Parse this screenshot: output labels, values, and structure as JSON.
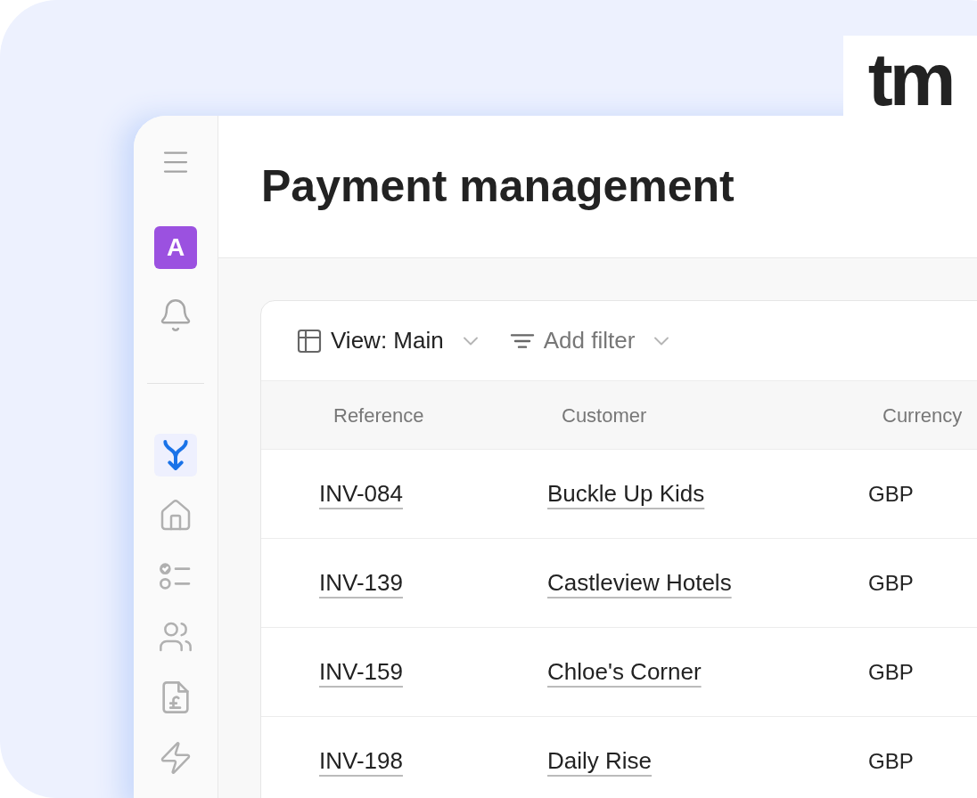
{
  "logo": {
    "text": "tm"
  },
  "sidebar": {
    "avatar": "A",
    "top_items": [
      {
        "kind": "menu"
      },
      {
        "kind": "avatar"
      },
      {
        "kind": "bell"
      }
    ],
    "nav_items": [
      {
        "kind": "merge",
        "selected": true
      },
      {
        "kind": "home",
        "selected": false
      },
      {
        "kind": "checklist",
        "selected": false
      },
      {
        "kind": "users",
        "selected": false
      },
      {
        "kind": "invoice",
        "selected": false
      },
      {
        "kind": "bolt",
        "selected": false
      }
    ]
  },
  "page": {
    "title": "Payment management"
  },
  "toolbar": {
    "view": "View: Main",
    "filter": "Add filter"
  },
  "table": {
    "columns": [
      "Reference",
      "Customer",
      "Currency"
    ],
    "rows": [
      {
        "reference": "INV-084",
        "customer": "Buckle Up Kids",
        "currency": "GBP"
      },
      {
        "reference": "INV-139",
        "customer": "Castleview Hotels",
        "currency": "GBP"
      },
      {
        "reference": "INV-159",
        "customer": "Chloe's Corner",
        "currency": "GBP"
      },
      {
        "reference": "INV-198",
        "customer": "Daily Rise",
        "currency": "GBP"
      }
    ]
  }
}
